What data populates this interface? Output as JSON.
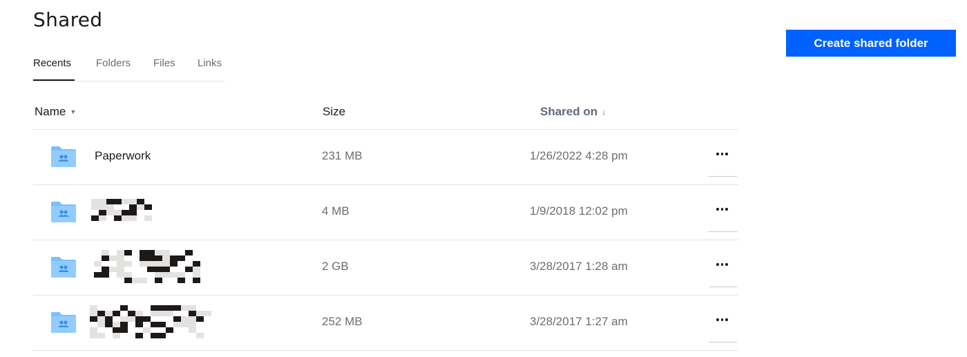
{
  "page": {
    "title": "Shared"
  },
  "actions": {
    "create_label": "Create shared folder"
  },
  "tabs": [
    {
      "label": "Recents",
      "active": true
    },
    {
      "label": "Folders",
      "active": false
    },
    {
      "label": "Files",
      "active": false
    },
    {
      "label": "Links",
      "active": false
    }
  ],
  "columns": {
    "name": "Name",
    "size": "Size",
    "shared_on": "Shared on",
    "sorted_by": "Shared on",
    "sort_direction": "descending"
  },
  "rows": [
    {
      "name": "Paperwork",
      "name_redacted": false,
      "size": "231 MB",
      "shared_on": "1/26/2022 4:28 pm",
      "icon": "shared-folder-icon"
    },
    {
      "name": "",
      "name_redacted": true,
      "size": "4 MB",
      "shared_on": "1/9/2018 12:02 pm",
      "icon": "shared-folder-icon"
    },
    {
      "name": "",
      "name_redacted": true,
      "size": "2 GB",
      "shared_on": "3/28/2017 1:28 am",
      "icon": "shared-folder-icon"
    },
    {
      "name": "",
      "name_redacted": true,
      "size": "252 MB",
      "shared_on": "3/28/2017 1:27 am",
      "icon": "shared-folder-icon"
    }
  ],
  "colors": {
    "accent": "#0061fe",
    "folder": "#7ac0ff",
    "folder_tab": "#a9d6ff",
    "text_primary": "#1e1919",
    "text_secondary": "#716c68",
    "divider": "#e6e4e1"
  },
  "icons": {
    "name_sort": "caret-down-icon",
    "shared_on_sort": "arrow-down-icon",
    "row_menu": "more-horizontal-icon"
  }
}
